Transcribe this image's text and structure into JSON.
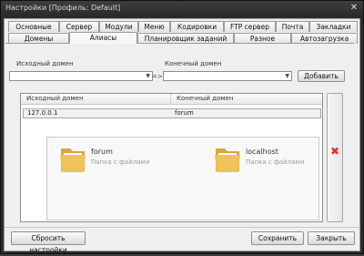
{
  "window": {
    "title": "Настройки [Профиль: Default]",
    "close_glyph": "✕"
  },
  "tabs_top": [
    "Основные",
    "Сервер",
    "Модули",
    "Меню",
    "Кодировки",
    "FTP сервер",
    "Почта",
    "Закладки"
  ],
  "tabs_bottom": [
    "Домены",
    "Алиасы",
    "Планировщик заданий",
    "Разное",
    "Автозагрузка"
  ],
  "active_tab": "Алиасы",
  "alias_form": {
    "source_label": "Исходный домен",
    "source_value": "",
    "arrow_text": "=>",
    "target_label": "Конечный домен",
    "target_value": "",
    "add_button": "Добавить"
  },
  "alias_table": {
    "columns": [
      "Исходный домен",
      "Конечный домен"
    ],
    "rows": [
      {
        "source": "127.0.0.1",
        "target": "forum"
      }
    ]
  },
  "folder_items": [
    {
      "name": "forum",
      "type": "Папка с файлами"
    },
    {
      "name": "localhost",
      "type": "Папка с файлами"
    }
  ],
  "footer": {
    "reset_button": "Сбросить настройки",
    "save_button": "Сохранить",
    "close_button": "Закрыть"
  },
  "colors": {
    "delete_icon": "#d33333",
    "folder": "#e8b84a"
  }
}
